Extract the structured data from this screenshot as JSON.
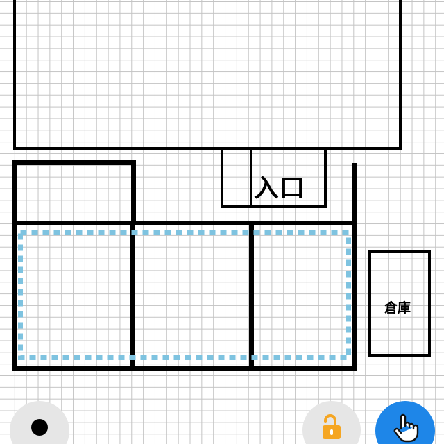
{
  "floor_plan": {
    "entrance_label": "入口",
    "storage_label": "倉庫"
  },
  "controls": {
    "record_icon": "record-dot-icon",
    "lock_icon": "unlocked-padlock-icon",
    "touch_icon": "pointing-hand-icon"
  },
  "colors": {
    "selection_outline": "#7ec3e0",
    "lock_icon": "#f5a623",
    "touch_button": "#1e86e8",
    "control_gray": "#e6e6e6",
    "grid_line": "#c4c4c4"
  }
}
